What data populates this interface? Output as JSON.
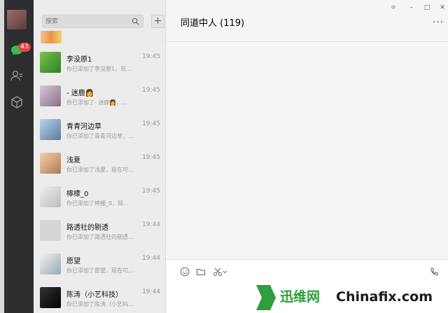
{
  "sidebar": {
    "unread_badge": "43",
    "icons": [
      "chat-icon",
      "contacts-icon",
      "favorites-icon"
    ]
  },
  "search": {
    "placeholder": "搜索"
  },
  "add_button": "+",
  "conversations": [
    {
      "name": "李没原1",
      "time": "19:45",
      "message": "你已添加了李没原1，现..."
    },
    {
      "name": "- 迷鹿👩",
      "time": "19:45",
      "message": "你已添加了- 迷鹿👩，..."
    },
    {
      "name": "青青河边草",
      "time": "19:45",
      "message": "你已添加了青青河边草，..."
    },
    {
      "name": "浅夏",
      "time": "19:45",
      "message": "你已添加了浅夏，现在可..."
    },
    {
      "name": "檸檬_0",
      "time": "19:45",
      "message": "你已添加了檸檬_0，现..."
    },
    {
      "name": "路透社的剔透",
      "time": "19:44",
      "message": "你已添加了路透社的剔透..."
    },
    {
      "name": "愿望",
      "time": "19:44",
      "message": "你已添加了愿望，现在可..."
    },
    {
      "name": "陈涛（小艺科技）",
      "time": "19:44",
      "message": "你已添加了陈涛（小艺科..."
    }
  ],
  "chat": {
    "title": "同道中人 (119)",
    "window_controls": {
      "pin": "፨",
      "minimize": "–",
      "maximize": "□",
      "close": "✕"
    },
    "more": "···"
  },
  "watermark": {
    "cn": "迅维网",
    "en": "Chinafix.com",
    "colors": {
      "green": "#2e9e3e",
      "dark": "#1a1a1a"
    }
  }
}
